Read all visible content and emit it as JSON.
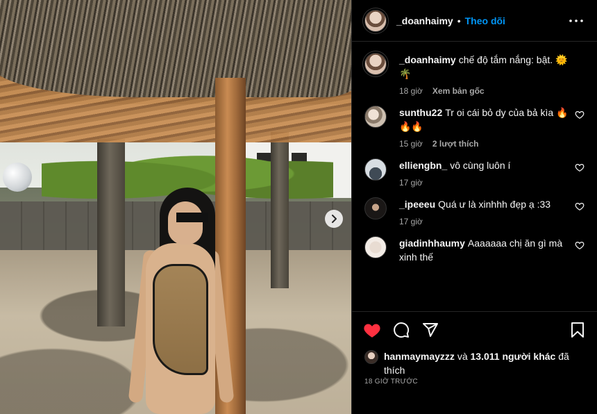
{
  "header": {
    "username": "_doanhaimy",
    "separator": "•",
    "follow_label": "Theo dõi",
    "more_icon": "more-horizontal-icon"
  },
  "caption": {
    "username": "_doanhaimy",
    "text": "chế độ tắm nắng: bật. 🌞🌴",
    "time": "18 giờ",
    "see_original": "Xem bản gốc"
  },
  "comments": [
    {
      "username": "sunthu22",
      "text": "Tr oi cái bỏ dy của bả kìa 🔥🔥🔥",
      "time": "15 giờ",
      "likes": "2 lượt thích"
    },
    {
      "username": "elliengbn_",
      "text": "vô cùng luôn í",
      "time": "17 giờ",
      "likes": ""
    },
    {
      "username": "_ipeeeu",
      "text": "Quá ư là xinhhh đẹp ạ :33",
      "time": "17 giờ",
      "likes": ""
    },
    {
      "username": "giadinhhaumy",
      "text": "Aaaaaaa chị ăn gì mà xinh thế",
      "time": "",
      "likes": ""
    }
  ],
  "actions": {
    "like_icon": "heart-filled-icon",
    "comment_icon": "comment-icon",
    "share_icon": "share-icon",
    "save_icon": "bookmark-icon",
    "like_color": "#ff3040"
  },
  "likes": {
    "user": "hanmaymayzzz",
    "connector": "và",
    "count_text": "13.011 người khác",
    "suffix": "đã thích"
  },
  "posted_time": "18 GIỜ TRƯỚC"
}
